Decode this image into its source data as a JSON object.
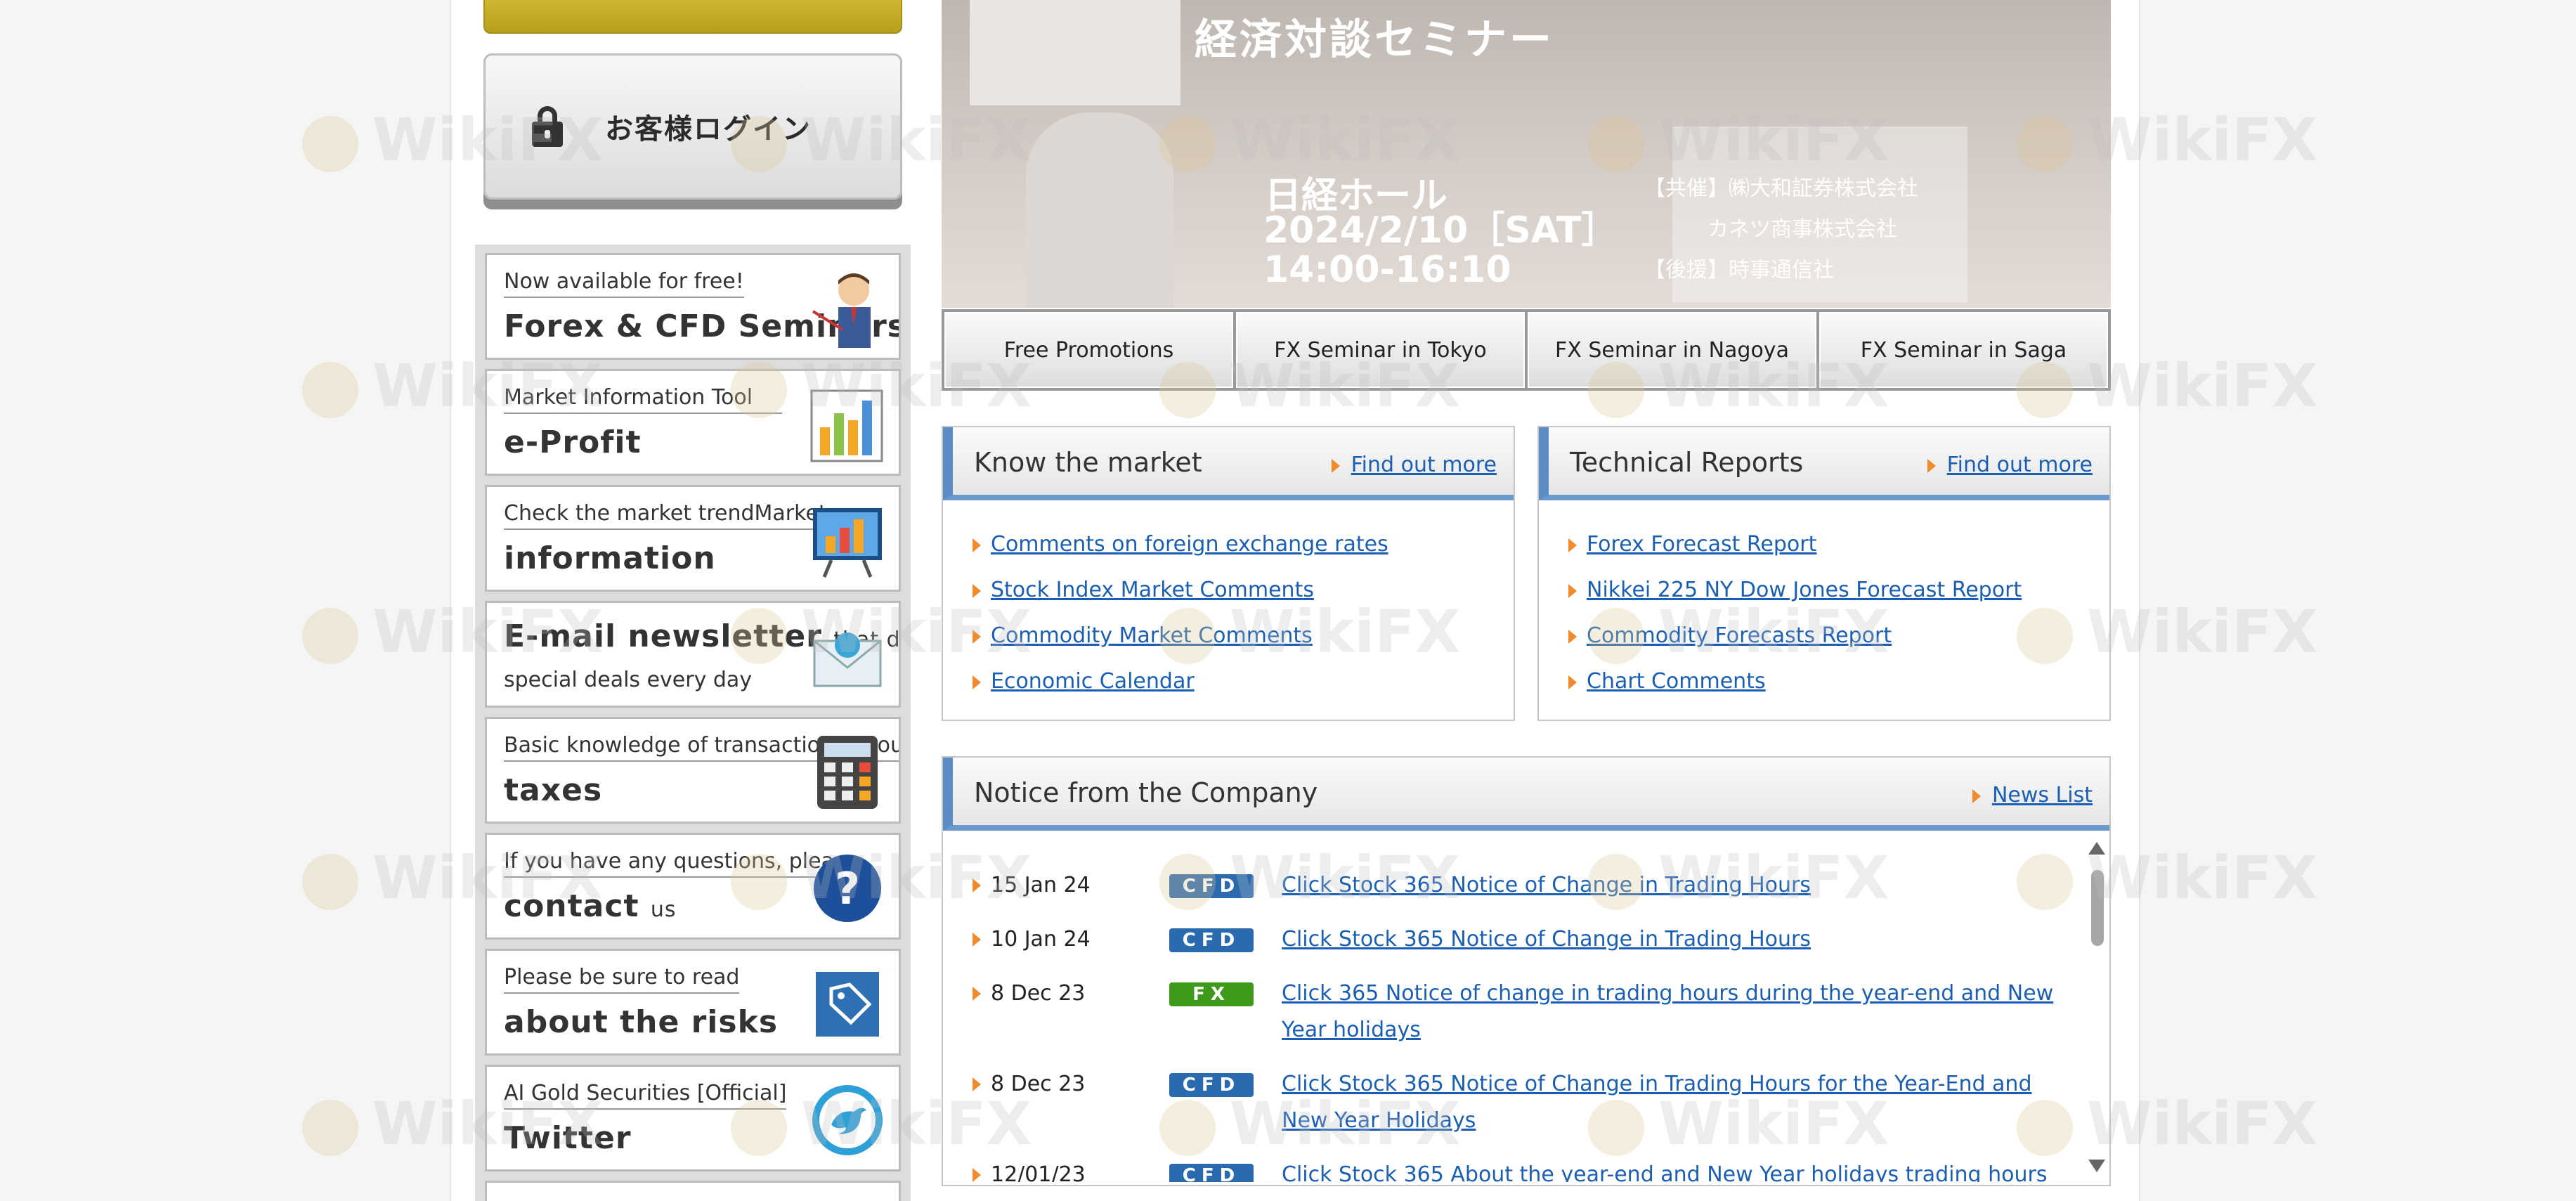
{
  "left": {
    "login_label": "お客様ログイン",
    "cards": [
      {
        "top": "Now available for free!",
        "main": "Forex & CFD Seminars",
        "main_small": "",
        "icon": "presenter-icon"
      },
      {
        "top": "Market Information Tool",
        "main": "e-Profit",
        "main_small": "",
        "icon": "bar-chart-icon"
      },
      {
        "top": "Check the market trendMarket",
        "main": "information",
        "main_small": "",
        "icon": "monitor-chart-icon"
      },
      {
        "top": "special deals every day",
        "main": "E-mail newsletter",
        "main_small": "that delivers",
        "icon": "envelope-icon"
      },
      {
        "top": "Basic knowledge of transactions about",
        "main": "taxes",
        "main_small": "",
        "icon": "calculator-icon"
      },
      {
        "top": "If you have any questions, please",
        "main": "contact",
        "main_small": "us",
        "icon": "question-icon"
      },
      {
        "top": "Please be sure to read",
        "main": "about the risks",
        "main_small": "",
        "icon": "tag-icon"
      },
      {
        "top": "AI Gold Securities [Official]",
        "main": "Twitter",
        "main_small": "",
        "icon": "twitter-bird-icon"
      }
    ]
  },
  "banner": {
    "title": "経済対談セミナー",
    "venue": "日経ホール",
    "date": "2024/2/10［SAT］",
    "time": "14:00-16:10",
    "co_label": "【共催】",
    "co1": "㈱大和証券株式会社",
    "co2": "カネツ商事株式会社",
    "sponsor_label": "【後援】",
    "sponsor": "時事通信社"
  },
  "tabs": [
    "Free Promotions",
    "FX Seminar in Tokyo",
    "FX Seminar in Nagoya",
    "FX Seminar in Saga"
  ],
  "know_market": {
    "title": "Know the market",
    "more": "Find out more",
    "links": [
      "Comments on foreign exchange rates",
      "Stock Index Market Comments",
      "Commodity Market Comments",
      "Economic Calendar"
    ]
  },
  "tech_reports": {
    "title": "Technical Reports",
    "more": "Find out more",
    "links": [
      "Forex Forecast Report",
      "Nikkei 225 NY Dow Jones Forecast Report",
      "Commodity Forecasts Report",
      "Chart Comments"
    ]
  },
  "notice": {
    "title": "Notice from the Company",
    "more": "News List",
    "rows": [
      {
        "date": "15 Jan 24",
        "badge": "CFD",
        "text": "Click Stock 365 Notice of Change in Trading Hours"
      },
      {
        "date": "10 Jan 24",
        "badge": "CFD",
        "text": "Click Stock 365 Notice of Change in Trading Hours"
      },
      {
        "date": "8 Dec 23",
        "badge": "FX",
        "text": "Click 365 Notice of change in trading hours during the year-end and New Year holidays"
      },
      {
        "date": "8 Dec 23",
        "badge": "CFD",
        "text": "Click Stock 365 Notice of Change in Trading Hours for the Year-End and New Year Holidays"
      },
      {
        "date": "12/01/23",
        "badge": "CFD",
        "text": "Click Stock 365 About the year-end and New Year holidays trading hours"
      }
    ]
  },
  "watermark": "WikiFX"
}
